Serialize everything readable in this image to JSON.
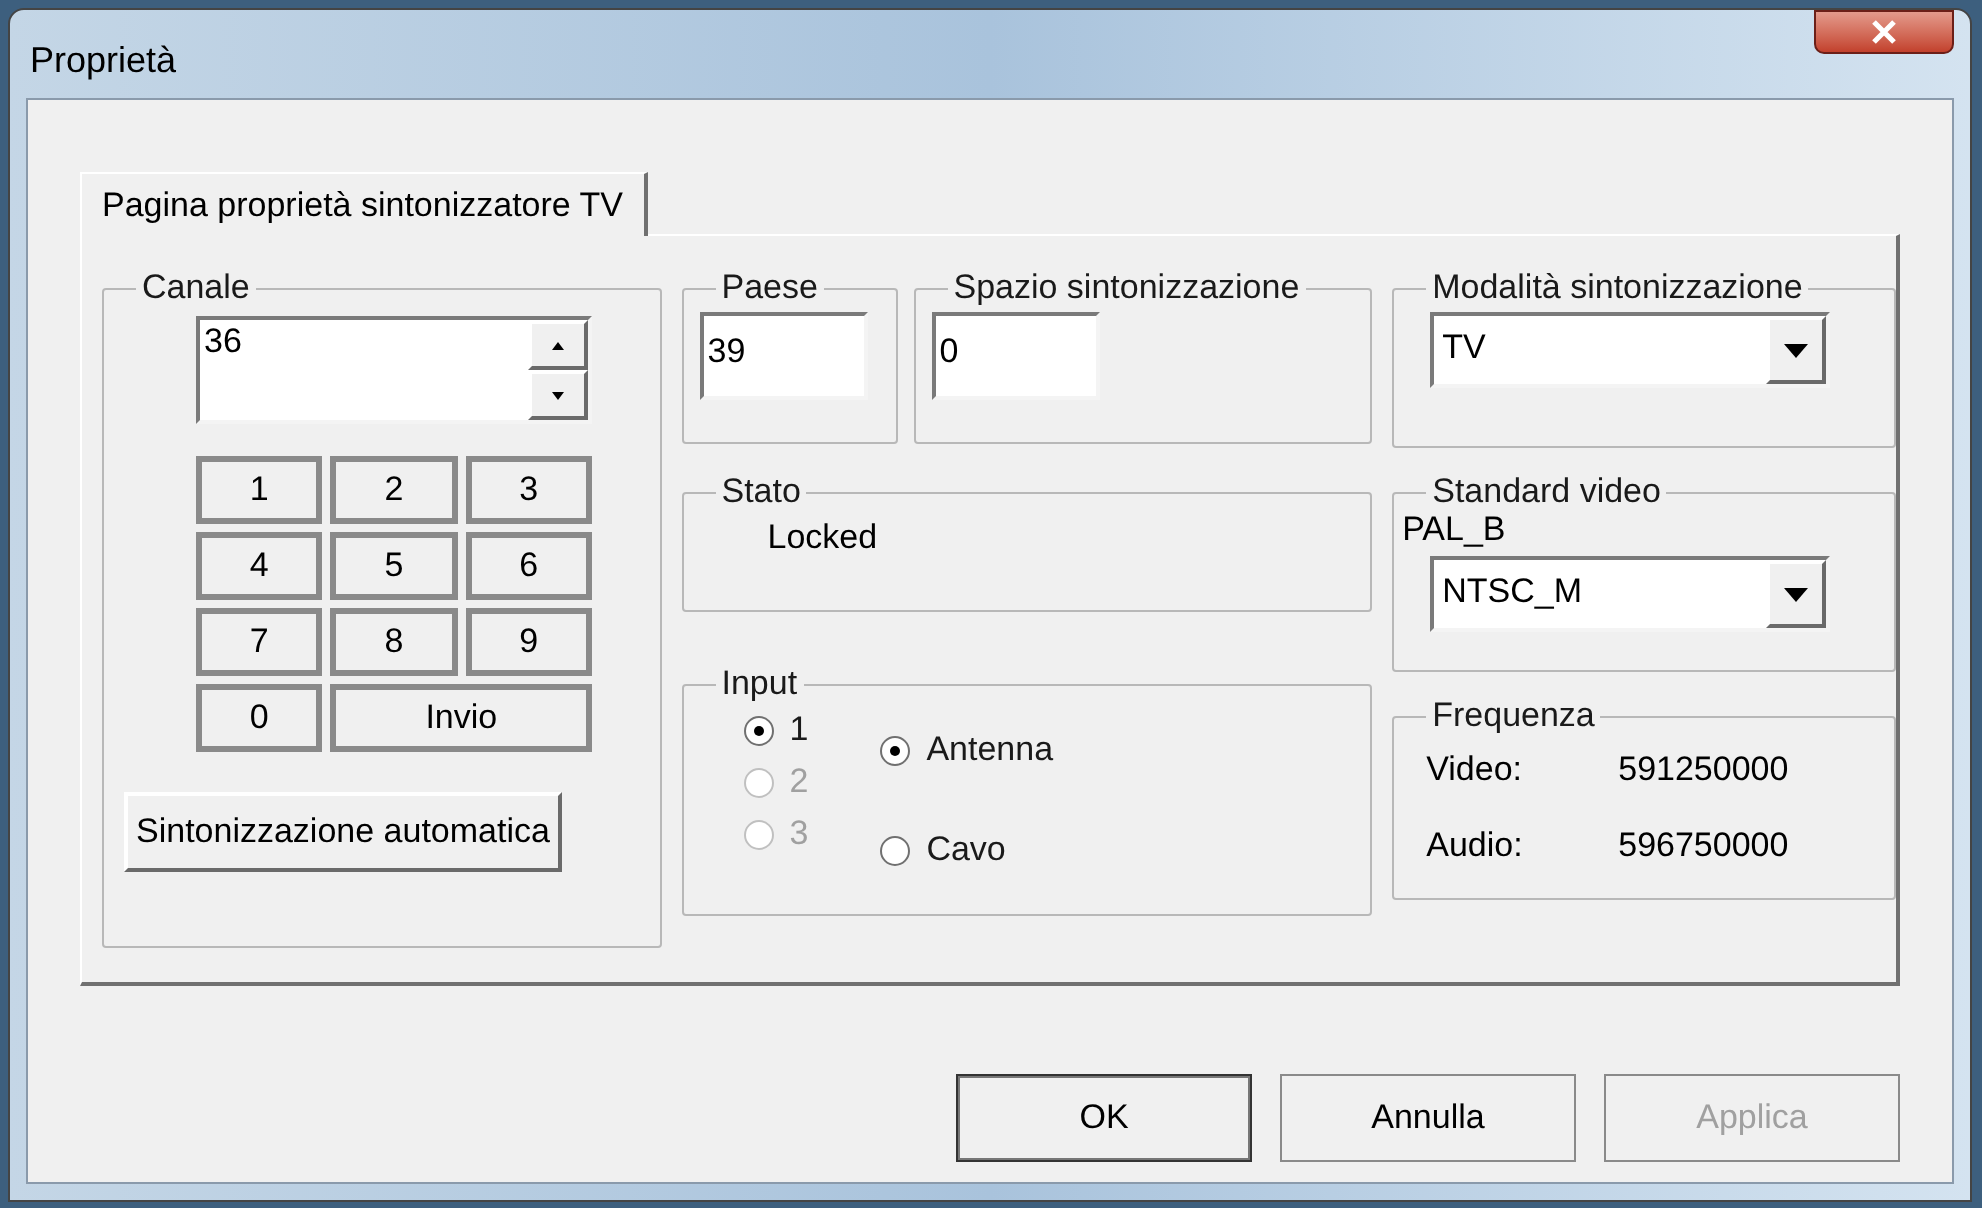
{
  "window": {
    "title": "Proprietà"
  },
  "tabs": [
    {
      "label": "Pagina proprietà sintonizzatore TV",
      "selected": true
    }
  ],
  "canale": {
    "legend": "Canale",
    "value": "36",
    "keypad": [
      {
        "label": "1",
        "kind": "digit"
      },
      {
        "label": "2",
        "kind": "digit"
      },
      {
        "label": "3",
        "kind": "digit"
      },
      {
        "label": "4",
        "kind": "digit"
      },
      {
        "label": "5",
        "kind": "digit"
      },
      {
        "label": "6",
        "kind": "digit"
      },
      {
        "label": "7",
        "kind": "digit"
      },
      {
        "label": "8",
        "kind": "digit"
      },
      {
        "label": "9",
        "kind": "digit"
      },
      {
        "label": "0",
        "kind": "digit"
      },
      {
        "label": "Invio",
        "kind": "wide"
      }
    ],
    "auto_button": "Sintonizzazione automatica"
  },
  "paese": {
    "legend": "Paese",
    "value": "39"
  },
  "spazio": {
    "legend": "Spazio sintonizzazione",
    "value": "0"
  },
  "stato": {
    "legend": "Stato",
    "value": "Locked"
  },
  "input": {
    "legend": "Input",
    "ports": [
      {
        "label": "1",
        "selected": true,
        "disabled": false
      },
      {
        "label": "2",
        "selected": false,
        "disabled": true
      },
      {
        "label": "3",
        "selected": false,
        "disabled": true
      }
    ],
    "sources": [
      {
        "label": "Antenna",
        "selected": true
      },
      {
        "label": "Cavo",
        "selected": false
      }
    ]
  },
  "modalita": {
    "legend": "Modalità sintonizzazione",
    "value": "TV"
  },
  "standard_video": {
    "legend": "Standard video",
    "current": "PAL_B",
    "value": "NTSC_M"
  },
  "frequenza": {
    "legend": "Frequenza",
    "rows": [
      {
        "label": "Video:",
        "value": "591250000"
      },
      {
        "label": "Audio:",
        "value": "596750000"
      }
    ]
  },
  "buttons": [
    {
      "label": "OK",
      "disabled": false,
      "default": true
    },
    {
      "label": "Annulla",
      "disabled": false,
      "default": false
    },
    {
      "label": "Applica",
      "disabled": true,
      "default": false
    }
  ]
}
